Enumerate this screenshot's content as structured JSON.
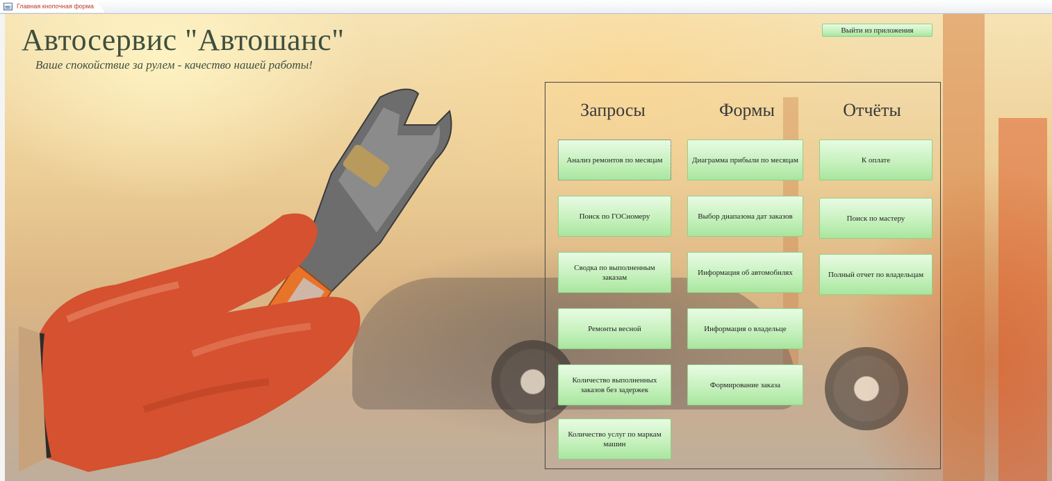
{
  "tab": {
    "label": "Главная кнопочная форма",
    "icon": "form-icon"
  },
  "header": {
    "title": "Автосервис \"Автошанс\"",
    "slogan": "Ваше спокойствие за рулем - качество нашей работы!"
  },
  "exit_button": "Выйти из приложения",
  "columns": {
    "queries": {
      "title": "Запросы",
      "buttons": [
        "Анализ ремонтов по месяцам",
        "Поиск по ГОСномеру",
        "Сводка по выполненным заказам",
        "Ремонты весной",
        "Количество выполненных заказов без задержек",
        "Количество услуг по маркам машин"
      ]
    },
    "forms": {
      "title": "Формы",
      "buttons": [
        "Диаграмма прибыли по месяцам",
        "Выбор диапазона дат заказов",
        "Информация об автомобилях",
        "Информация о владельце",
        "Формирование заказа"
      ]
    },
    "reports": {
      "title": "Отчёты",
      "buttons": [
        "К оплате",
        "Поиск по мастеру",
        "Полный отчет по владельцам"
      ]
    }
  },
  "colors": {
    "button_green": "#c4f0bb",
    "title_text": "#3e4f3f",
    "tab_label": "#c0392b"
  }
}
